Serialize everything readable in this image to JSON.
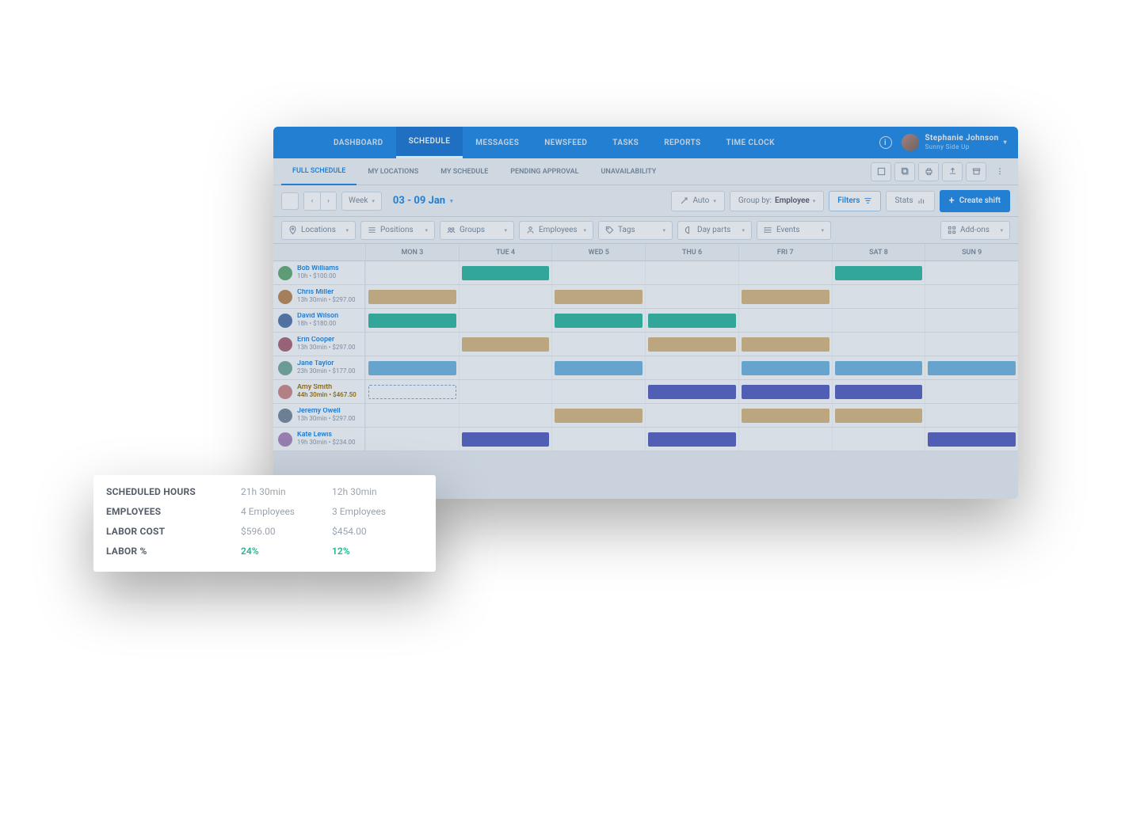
{
  "nav": {
    "items": [
      "DASHBOARD",
      "SCHEDULE",
      "MESSAGES",
      "NEWSFEED",
      "TASKS",
      "REPORTS",
      "TIME CLOCK"
    ],
    "active": "SCHEDULE"
  },
  "user": {
    "name": "Stephanie Johnson",
    "company": "Sunny Side Up"
  },
  "subnav": {
    "items": [
      "FULL SCHEDULE",
      "MY LOCATIONS",
      "MY SCHEDULE",
      "PENDING APPROVAL",
      "UNAVAILABILITY"
    ],
    "active": "FULL SCHEDULE"
  },
  "toolbar": {
    "view_mode": "Week",
    "date_range": "03 - 09 Jan",
    "auto": "Auto",
    "groupby_label": "Group by:",
    "groupby_value": "Employee",
    "filters": "Filters",
    "stats": "Stats",
    "create_shift": "Create shift"
  },
  "filters": {
    "locations": "Locations",
    "positions": "Positions",
    "groups": "Groups",
    "employees": "Employees",
    "tags": "Tags",
    "dayparts": "Day parts",
    "events": "Events",
    "addons": "Add-ons"
  },
  "days": [
    "MON 3",
    "TUE 4",
    "WED 5",
    "THU 6",
    "FRI 7",
    "SAT 8",
    "SUN 9"
  ],
  "employees": [
    {
      "name": "Bob Williams",
      "sub": "10h • $100.00",
      "shifts": {
        "TUE 4": "teal",
        "SAT 8": "teal"
      }
    },
    {
      "name": "Chris Miller",
      "sub": "13h 30min • $297.00",
      "shifts": {
        "MON 3": "tan",
        "WED 5": "tan",
        "FRI 7": "tan"
      }
    },
    {
      "name": "David Wilson",
      "sub": "18h • $180.00",
      "shifts": {
        "MON 3": "teal",
        "WED 5": "teal",
        "THU 6": "teal"
      }
    },
    {
      "name": "Erin Cooper",
      "sub": "13h 30min • $297.00",
      "shifts": {
        "TUE 4": "tan",
        "THU 6": "tan",
        "FRI 7": "tan"
      }
    },
    {
      "name": "Jane Taylor",
      "sub": "23h 30min • $177.00",
      "shifts": {
        "MON 3": "blue",
        "WED 5": "blue",
        "FRI 7": "blue",
        "SAT 8": "blue",
        "SUN 9": "blue"
      }
    },
    {
      "name": "Amy Smith",
      "sub": "44h 30min • $467.50",
      "highlight": true,
      "shifts": {
        "MON 3": "dashed",
        "THU 6": "indigo",
        "FRI 7": "indigo",
        "SAT 8": "indigo"
      }
    },
    {
      "name": "Jeremy Owell",
      "sub": "13h 30min • $297.00",
      "shifts": {
        "WED 5": "tan",
        "FRI 7": "tan",
        "SAT 8": "tan"
      }
    },
    {
      "name": "Kate Lewis",
      "sub": "19h 30min • $234.00",
      "shifts": {
        "TUE 4": "indigo",
        "THU 6": "indigo",
        "SUN 9": "indigo"
      }
    }
  ],
  "stats": {
    "rows": [
      {
        "label": "SCHEDULED HOURS",
        "c1": "21h 30min",
        "c2": "12h 30min"
      },
      {
        "label": "EMPLOYEES",
        "c1": "4 Employees",
        "c2": "3 Employees"
      },
      {
        "label": "LABOR COST",
        "c1": "$596.00",
        "c2": "$454.00"
      },
      {
        "label": "LABOR %",
        "c1": "24%",
        "c2": "12%",
        "green": true
      }
    ]
  },
  "colors": {
    "teal": "#2fb8a0",
    "tan": "#d8b880",
    "blue": "#6fb5e0",
    "indigo": "#5560c0",
    "brand": "#1e88e5"
  }
}
